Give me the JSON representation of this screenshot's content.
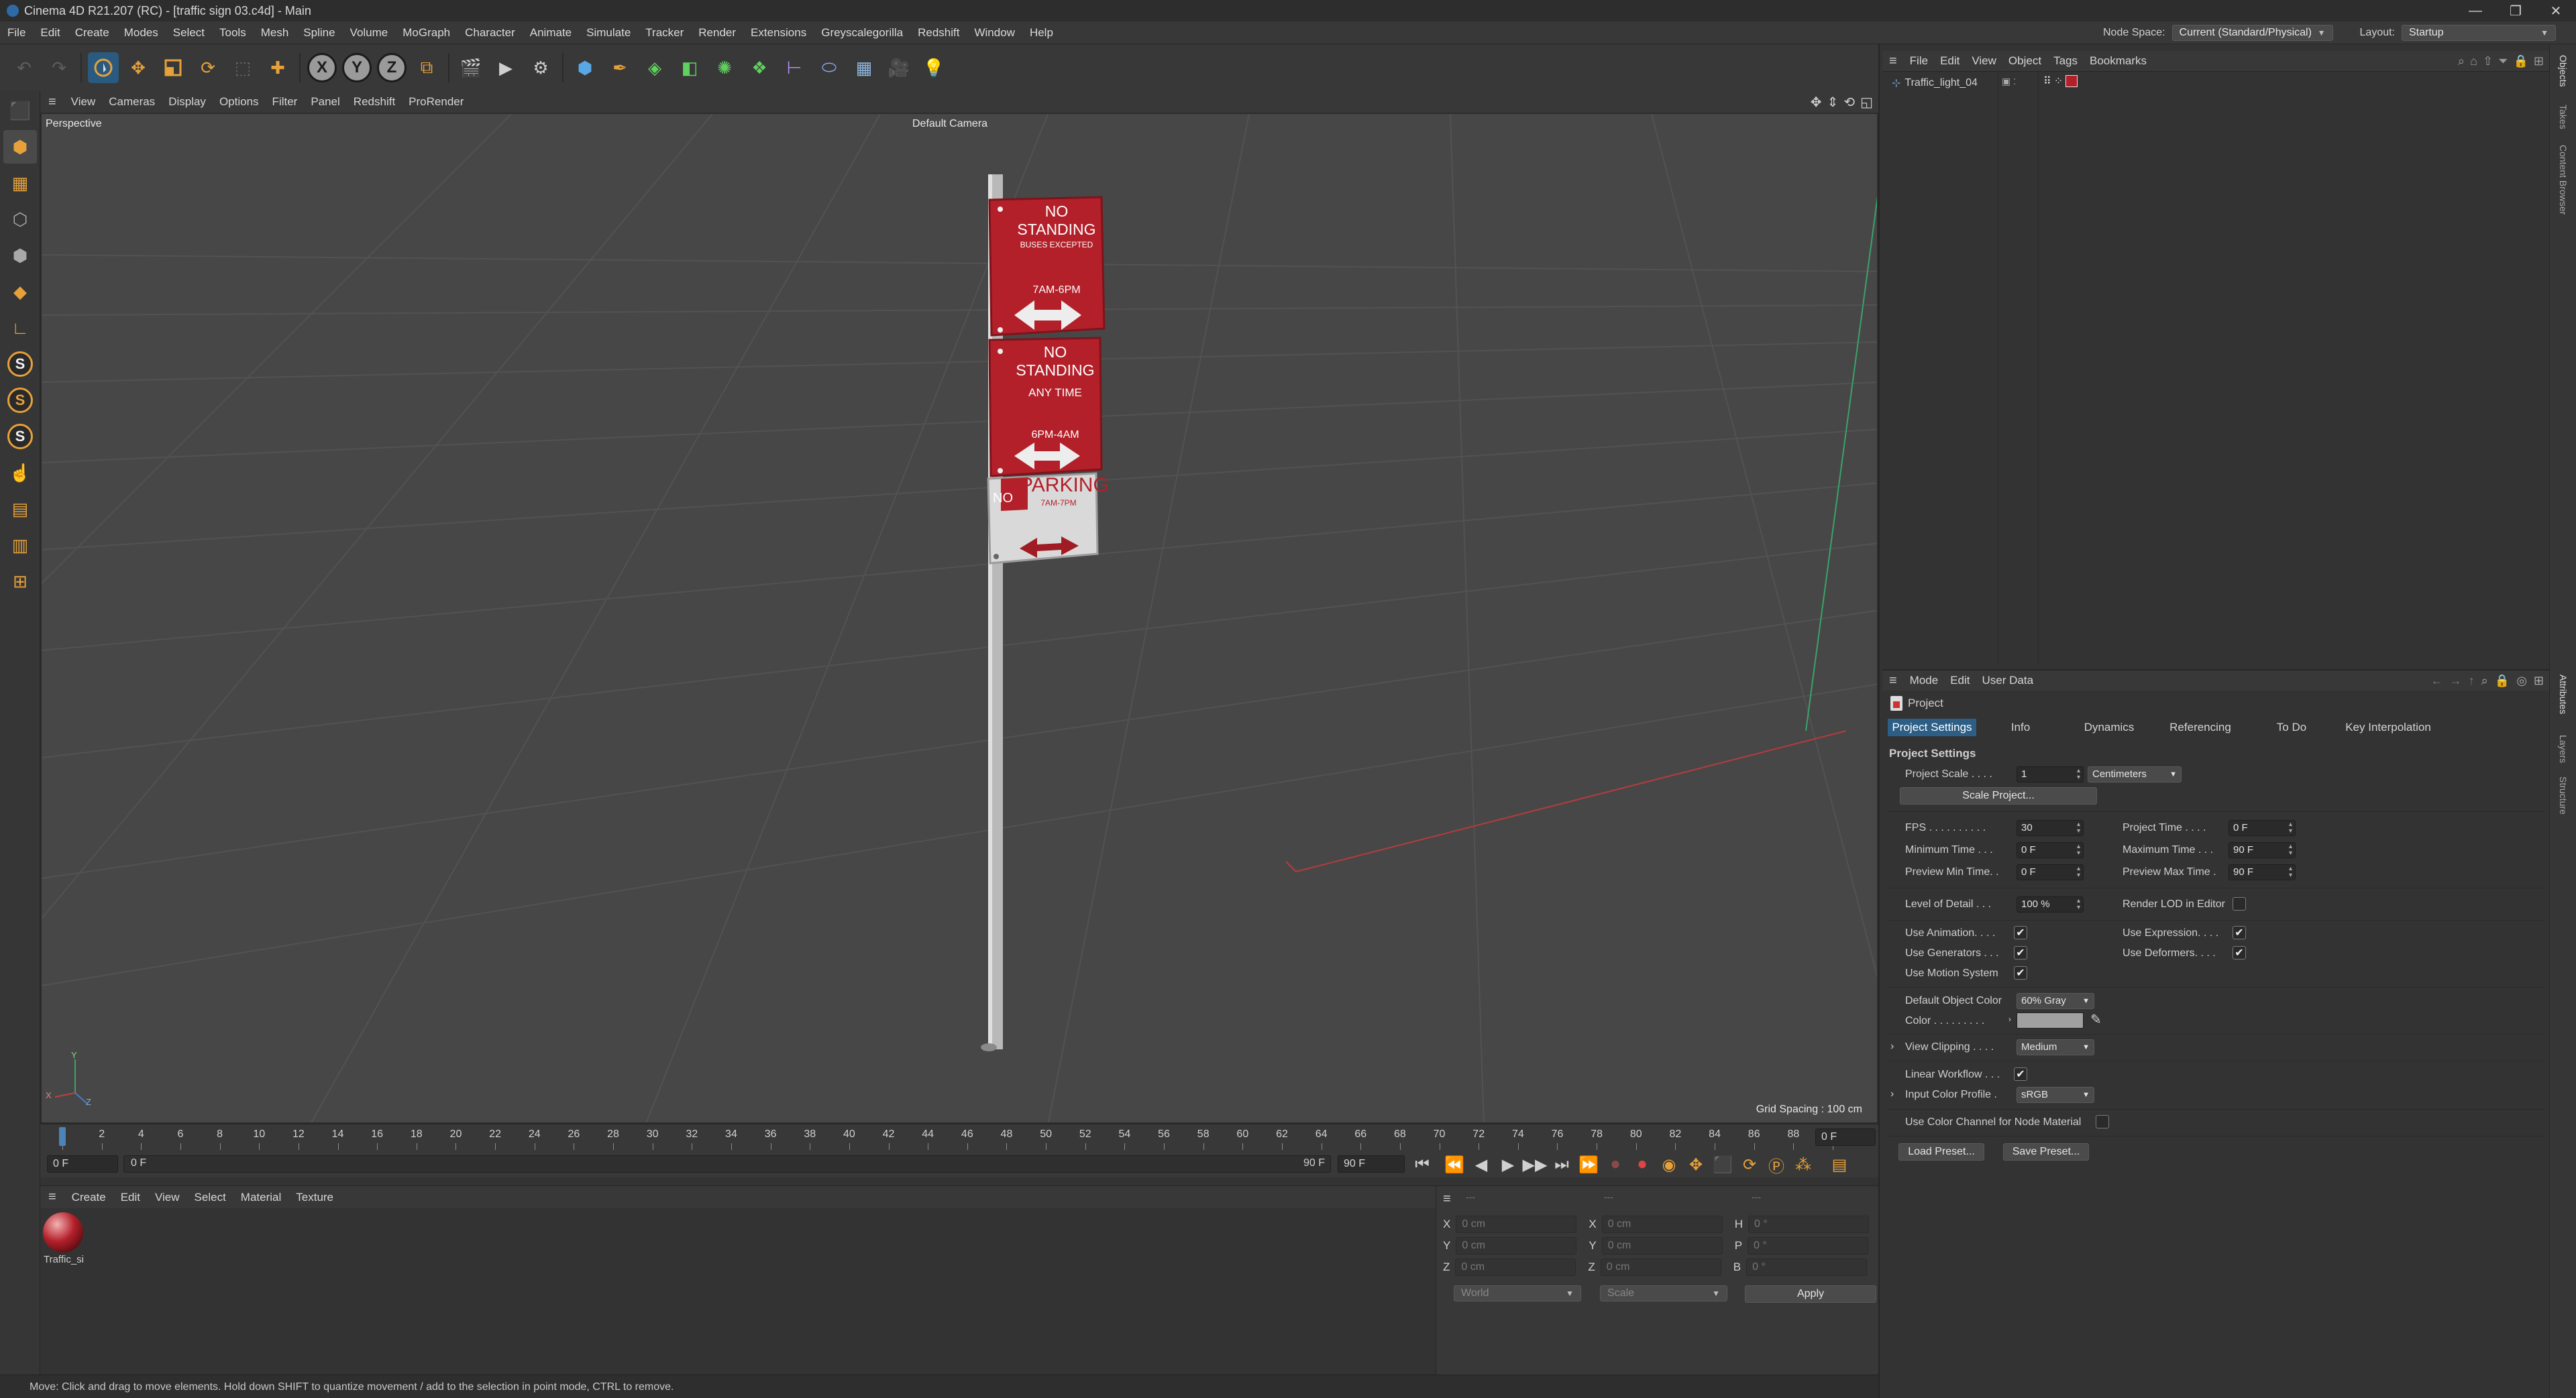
{
  "window": {
    "title": "Cinema 4D R21.207 (RC) - [traffic sign 03.c4d] - Main",
    "controls": [
      "—",
      "❐",
      "✕"
    ]
  },
  "menubar": {
    "items": [
      "File",
      "Edit",
      "Create",
      "Modes",
      "Select",
      "Tools",
      "Mesh",
      "Spline",
      "Volume",
      "MoGraph",
      "Character",
      "Animate",
      "Simulate",
      "Tracker",
      "Render",
      "Extensions",
      "Greyscalegorilla",
      "Redshift",
      "Window",
      "Help"
    ],
    "node_space_label": "Node Space:",
    "node_space_value": "Current (Standard/Physical)",
    "layout_label": "Layout:",
    "layout_value": "Startup"
  },
  "viewport": {
    "menu": [
      "View",
      "Cameras",
      "Display",
      "Options",
      "Filter",
      "Panel",
      "Redshift",
      "ProRender"
    ],
    "projection": "Perspective",
    "camera": "Default Camera",
    "grid_spacing": "Grid Spacing : 100 cm",
    "axis_labels": [
      "Y",
      "X",
      "Z"
    ],
    "sign1": {
      "line1": "NO STANDING",
      "line2": "BUSES EXCEPTED",
      "line3": "7AM-6PM"
    },
    "sign2": {
      "line1": "NO STANDING",
      "line2": "ANY TIME",
      "line3": "6PM-4AM"
    },
    "sign3": {
      "prefix": "NO",
      "line1": "PARKING",
      "line2": "7AM-7PM"
    },
    "colors": {
      "sign_red": "#b3202a",
      "sign_white": "#dcdcdc",
      "grid": "#525252",
      "bg": "#474747"
    }
  },
  "timeline": {
    "ticks": [
      "0",
      "2",
      "4",
      "6",
      "8",
      "10",
      "12",
      "14",
      "16",
      "18",
      "20",
      "22",
      "24",
      "26",
      "28",
      "30",
      "32",
      "34",
      "36",
      "38",
      "40",
      "42",
      "44",
      "46",
      "48",
      "50",
      "52",
      "54",
      "56",
      "58",
      "60",
      "62",
      "64",
      "66",
      "68",
      "70",
      "72",
      "74",
      "76",
      "78",
      "80",
      "82",
      "84",
      "86",
      "88",
      "90"
    ],
    "current_frame_right": "0 F",
    "start_field": "0 F",
    "preview_start": "0 F",
    "preview_end": "90 F",
    "end_field": "90 F"
  },
  "material_manager": {
    "menu": [
      "Create",
      "Edit",
      "View",
      "Select",
      "Material",
      "Texture"
    ],
    "materials": [
      {
        "name": "Traffic_si"
      }
    ]
  },
  "coordinates": {
    "rows": [
      {
        "a": "X",
        "av": "0 cm",
        "b": "X",
        "bv": "0 cm",
        "c": "H",
        "cv": "0 °"
      },
      {
        "a": "Y",
        "av": "0 cm",
        "b": "Y",
        "bv": "0 cm",
        "c": "P",
        "cv": "0 °"
      },
      {
        "a": "Z",
        "av": "0 cm",
        "b": "Z",
        "bv": "0 cm",
        "c": "B",
        "cv": "0 °"
      }
    ],
    "space": "World",
    "mode": "Scale",
    "apply": "Apply",
    "header_dashes": "---"
  },
  "statusbar": {
    "text": "Move: Click and drag to move elements. Hold down SHIFT to quantize movement / add to the selection in point mode, CTRL to remove."
  },
  "object_manager": {
    "menu": [
      "File",
      "Edit",
      "View",
      "Object",
      "Tags",
      "Bookmarks"
    ],
    "objects": [
      {
        "name": "Traffic_light_04"
      }
    ]
  },
  "right_tabs": {
    "top": [
      "Objects",
      "Takes",
      "Content Browser"
    ],
    "bottom": [
      "Attributes",
      "Layers",
      "Structure"
    ]
  },
  "attributes": {
    "menu": [
      "Mode",
      "Edit",
      "User Data"
    ],
    "object_title": "Project",
    "tabs": [
      "Project Settings",
      "Info",
      "Dynamics",
      "Referencing",
      "To Do",
      "Key Interpolation"
    ],
    "section": "Project Settings",
    "project_scale_label": "Project Scale . . . .",
    "project_scale_value": "1",
    "project_scale_unit": "Centimeters",
    "scale_project_btn": "Scale Project...",
    "fps_label": "FPS . . . . . . . . . .",
    "fps_value": "30",
    "project_time_label": "Project Time . . . .",
    "project_time_value": "0 F",
    "min_time_label": "Minimum Time . . .",
    "min_time_value": "0 F",
    "max_time_label": "Maximum Time . . .",
    "max_time_value": "90 F",
    "prev_min_label": "Preview Min Time. .",
    "prev_min_value": "0 F",
    "prev_max_label": "Preview Max Time .",
    "prev_max_value": "90 F",
    "lod_label": "Level of Detail . . .",
    "lod_value": "100 %",
    "render_lod_label": "Render LOD in Editor",
    "use_animation_label": "Use Animation. . . .",
    "use_expression_label": "Use Expression. . . .",
    "use_generators_label": "Use Generators . . .",
    "use_deformers_label": "Use Deformers. . . .",
    "use_motion_label": "Use Motion System",
    "default_color_label": "Default Object Color",
    "default_color_value": "60% Gray",
    "color_label": "Color . . . . . . . . .",
    "view_clipping_label": "View Clipping . . . .",
    "view_clipping_value": "Medium",
    "linear_workflow_label": "Linear Workflow . . .",
    "input_profile_label": "Input Color Profile .",
    "input_profile_value": "sRGB",
    "color_channel_label": "Use Color Channel for Node Material",
    "load_preset": "Load Preset...",
    "save_preset": "Save Preset...",
    "checks": {
      "use_animation": true,
      "use_expression": true,
      "use_generators": true,
      "use_deformers": true,
      "use_motion": true,
      "render_lod": false,
      "linear_workflow": true,
      "color_channel": false
    }
  }
}
